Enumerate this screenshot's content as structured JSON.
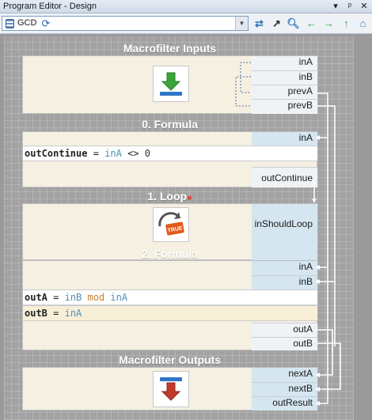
{
  "window": {
    "title": "Program Editor - Design",
    "title_buttons": [
      "▾",
      "ᵖ",
      "✕"
    ]
  },
  "toolbar": {
    "program_name": "GCD",
    "program_icon": "database-icon",
    "icons": [
      "swap-icon",
      "external-link-icon",
      "magnifier-icon",
      "arrow-left-icon",
      "arrow-right-icon",
      "arrow-up-icon",
      "home-icon"
    ]
  },
  "inputs": {
    "title": "Macrofilter Inputs",
    "ports": [
      "inA",
      "inB",
      "prevA",
      "prevB"
    ]
  },
  "formula0": {
    "title": "0. Formula",
    "in_ports": [
      "inA"
    ],
    "lines": [
      {
        "lhs": "outContinue",
        "eq": " = ",
        "a": "inA",
        "op": " <> ",
        "b": "0"
      }
    ],
    "out_ports": [
      "outContinue"
    ]
  },
  "loop": {
    "title": "1. Loop",
    "icon_label": "TRUE",
    "in_ports": [
      "inShouldLoop"
    ]
  },
  "formula2": {
    "title": "2. Formula",
    "in_ports": [
      "inA",
      "inB"
    ],
    "lines": [
      {
        "lhs": "outA",
        "eq": " = ",
        "a": "inB",
        "op": " mod ",
        "b": "inA"
      },
      {
        "lhs": "outB",
        "eq": " = ",
        "a": "inA",
        "op": "",
        "b": ""
      }
    ],
    "out_ports": [
      "outA",
      "outB"
    ]
  },
  "outputs": {
    "title": "Macrofilter Outputs",
    "ports": [
      "nextA",
      "nextB",
      "outResult"
    ]
  },
  "colors": {
    "accent": "#4f8fb0",
    "port_in": "#d5e6f0",
    "block_bg": "#f5f0e2",
    "green_arrow": "#3aa53a",
    "red_arrow": "#c0392b"
  }
}
